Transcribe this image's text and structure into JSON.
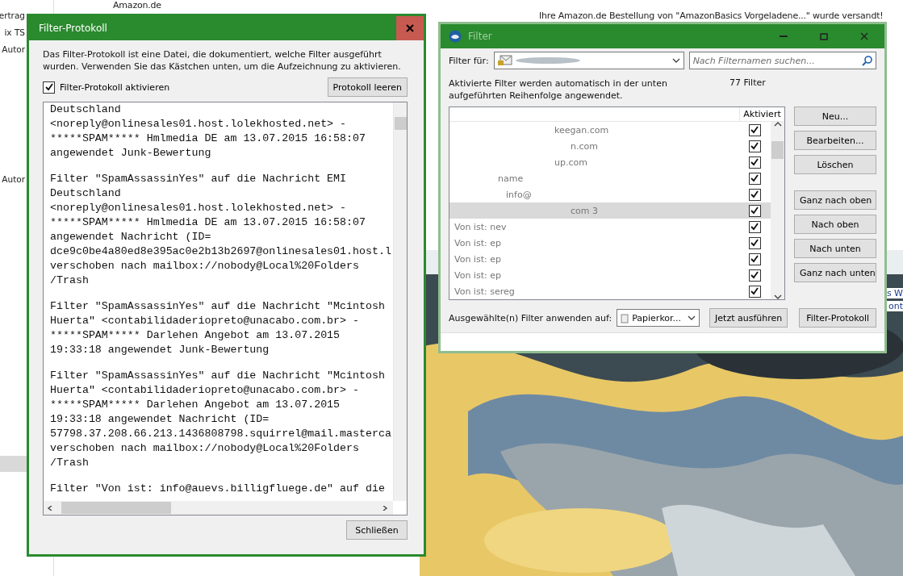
{
  "background": {
    "sidebar_items": [
      {
        "label": "ertrag",
        "selected": false
      },
      {
        "label": "ix TS",
        "selected": false
      },
      {
        "label": "Autor",
        "selected": false
      },
      {
        "label": "Autor",
        "selected": false
      },
      {
        "selected": true
      }
    ],
    "top_sender": "Amazon.de",
    "top_subject": "Ihre Amazon.de Bestellung von \"AmazonBasics Vorgeladene...\" wurde versandt!",
    "edge_texts": [
      "s W",
      "ont"
    ]
  },
  "log_window": {
    "title": "Filter-Protokoll",
    "description": "Das Filter-Protokoll ist eine Datei, die dokumentiert, welche Filter ausgeführt wurden. Verwenden Sie das Kästchen unten, um die Aufzeichnung zu aktivieren.",
    "enable_checkbox": {
      "label": "Filter-Protokoll aktivieren",
      "checked": true
    },
    "clear_button": "Protokoll leeren",
    "log_entries": [
      [
        "Deutschland",
        "<noreply@onlinesales01.host.lolekhosted.net> -",
        "*****SPAM***** Hmlmedia DE am 13.07.2015 16:58:07",
        "angewendet Junk-Bewertung"
      ],
      [
        "Filter \"SpamAssassinYes\" auf die Nachricht EMI",
        "Deutschland",
        "<noreply@onlinesales01.host.lolekhosted.net> -",
        "*****SPAM***** Hmlmedia DE am 13.07.2015 16:58:07",
        "angewendet Nachricht (ID=",
        "dce9c0be4a80ed8e395ac0e2b13b2697@onlinesales01.host.l",
        "verschoben nach mailbox://nobody@Local%20Folders",
        "/Trash"
      ],
      [
        "Filter \"SpamAssassinYes\" auf die Nachricht \"Mcintosh",
        "Huerta\" <contabilidaderiopreto@unacabo.com.br> -",
        "*****SPAM***** Darlehen Angebot am 13.07.2015",
        "19:33:18 angewendet Junk-Bewertung"
      ],
      [
        "Filter \"SpamAssassinYes\" auf die Nachricht \"Mcintosh",
        "Huerta\" <contabilidaderiopreto@unacabo.com.br> -",
        "*****SPAM***** Darlehen Angebot am 13.07.2015",
        "19:33:18 angewendet Nachricht (ID=",
        "57798.37.208.66.213.1436808798.squirrel@mail.masterca",
        "verschoben nach mailbox://nobody@Local%20Folders",
        "/Trash"
      ],
      [
        "Filter \"Von ist: info@auevs.billigfluege.de\" auf die"
      ]
    ],
    "close_button": "Schließen"
  },
  "filter_window": {
    "title": "Filter",
    "account_label": "Filter für:",
    "search": {
      "placeholder": "Nach Filternamen suchen..."
    },
    "info": "Aktivierte Filter werden automatisch in der unten aufgeführten Reihenfolge angewendet.",
    "count": "77 Filter",
    "column_header": "Aktiviert",
    "filters": [
      {
        "name": "keegan.com",
        "checked": true,
        "selected": false
      },
      {
        "name": "n.com",
        "checked": true,
        "selected": false
      },
      {
        "name": "up.com",
        "checked": true,
        "selected": false
      },
      {
        "name": "name",
        "checked": true,
        "selected": false
      },
      {
        "name": "info@",
        "checked": true,
        "selected": false
      },
      {
        "name": "com 3",
        "checked": true,
        "selected": true
      },
      {
        "name": "Von ist: nev",
        "checked": true,
        "selected": false
      },
      {
        "name": "Von ist: ep",
        "checked": true,
        "selected": false
      },
      {
        "name": "Von ist: ep",
        "checked": true,
        "selected": false
      },
      {
        "name": "Von ist: ep",
        "checked": true,
        "selected": false
      },
      {
        "name": "Von ist: sereg",
        "checked": true,
        "selected": false
      }
    ],
    "side_buttons": [
      [
        "Neu...",
        "Bearbeiten...",
        "Löschen"
      ],
      [
        "Ganz nach oben",
        "Nach oben",
        "Nach unten",
        "Ganz nach unten"
      ]
    ],
    "apply_label": "Ausgewählte(n) Filter anwenden auf:",
    "apply_target": "Papierkor...",
    "run_button": "Jetzt ausführen",
    "log_button": "Filter-Protokoll"
  }
}
